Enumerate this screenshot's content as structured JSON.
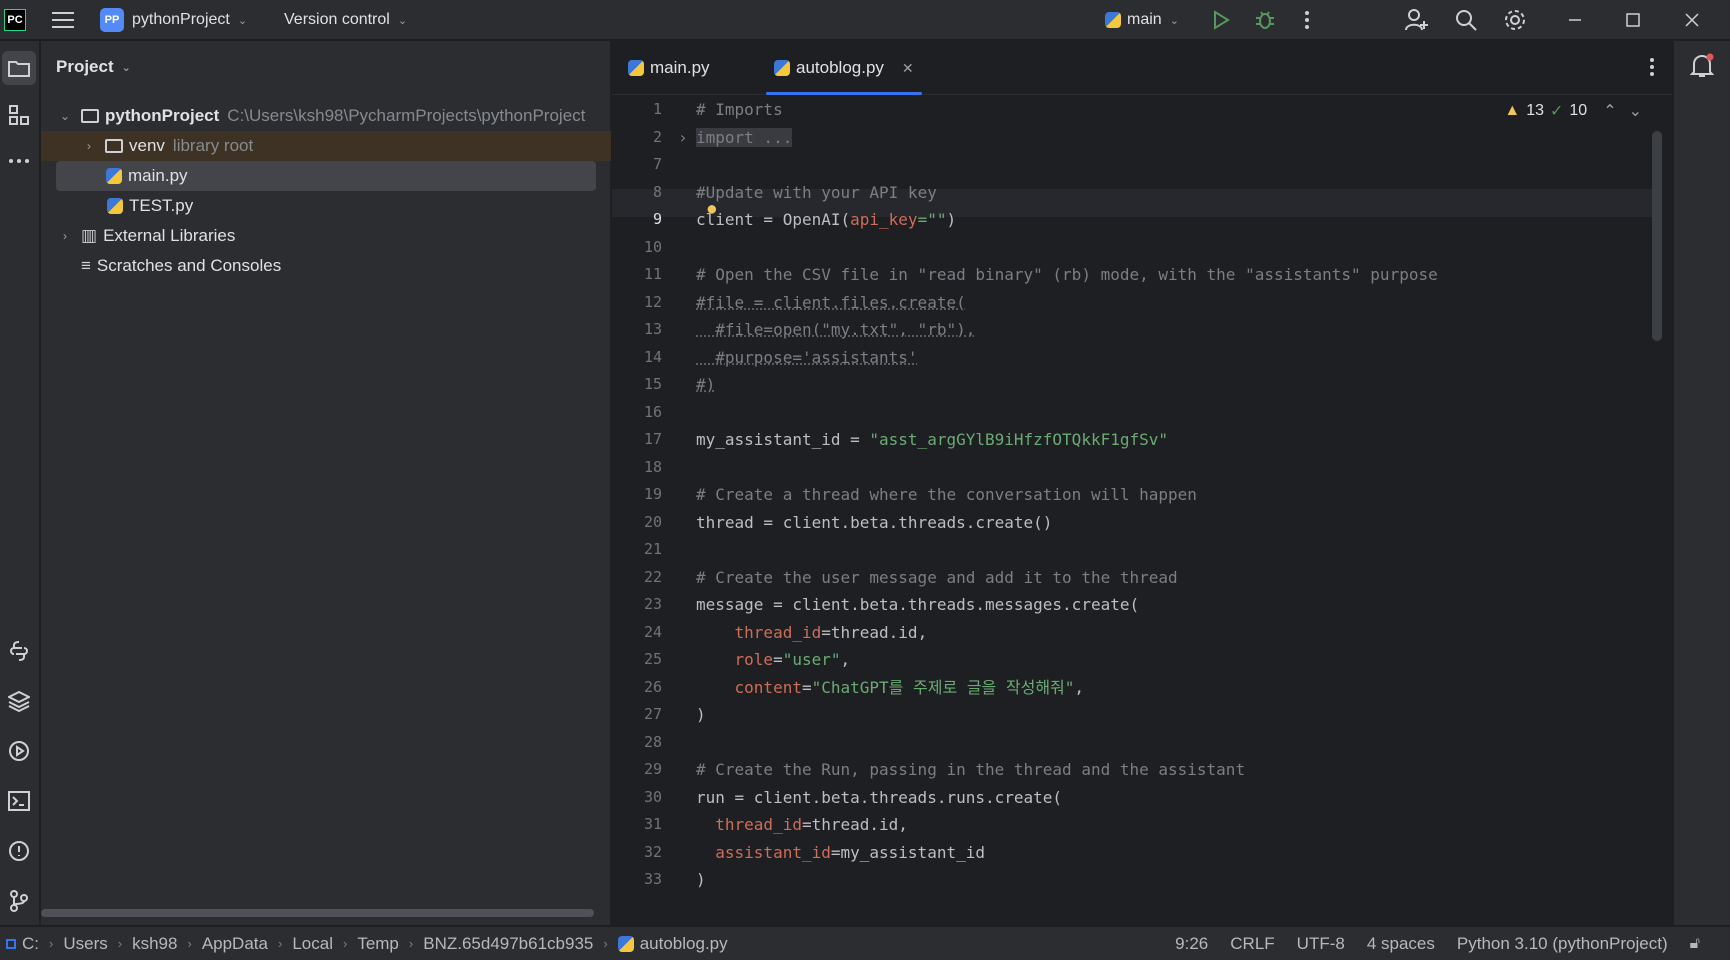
{
  "titlebar": {
    "project_badge": "PP",
    "project_name": "pythonProject",
    "vcs_label": "Version control",
    "run_config": "main",
    "icons": [
      "menu-icon",
      "run-icon",
      "debug-icon",
      "more-icon",
      "add-user-icon",
      "search-icon",
      "gear-icon",
      "minimize-icon",
      "maximize-icon",
      "close-icon"
    ]
  },
  "project_panel": {
    "title": "Project",
    "root_name": "pythonProject",
    "root_path": "C:\\Users\\ksh98\\PycharmProjects\\pythonProject",
    "venv_name": "venv",
    "venv_hint": "library root",
    "files": [
      "main.py",
      "TEST.py"
    ],
    "external_libraries": "External Libraries",
    "scratches": "Scratches and Consoles"
  },
  "editor": {
    "tabs": [
      {
        "label": "main.py"
      },
      {
        "label": "autoblog.py"
      }
    ],
    "warnings": "13",
    "ok_count": "10",
    "line_numbers": [
      "1",
      "2",
      "7",
      "8",
      "9",
      "10",
      "11",
      "12",
      "13",
      "14",
      "15",
      "16",
      "17",
      "18",
      "19",
      "20",
      "21",
      "22",
      "23",
      "24",
      "25",
      "26",
      "27",
      "28",
      "29",
      "30",
      "31",
      "32",
      "33"
    ],
    "code": {
      "l1": "# Imports",
      "l2": "import ...",
      "l8_a": "#",
      "l8_b": "Update with your API key",
      "l9_a": "client = OpenAI(",
      "l9_b": "api_key",
      "l9_c": "=\"\"",
      "l9_d": ")",
      "l11": "# Open the CSV file in \"read binary\" (rb) mode, with the \"assistants\" purpose",
      "l12": "#file = client.files.create(",
      "l13": "  #file=open(\"my.txt\", \"rb\"),",
      "l14": "  #purpose='assistants'",
      "l15": "#)",
      "l17_a": "my_assistant_id = ",
      "l17_b": "\"asst_argGYlB9iHfzfOTQkkF1gfSv\"",
      "l19": "# Create a thread where the conversation will happen",
      "l20": "thread = client.beta.threads.create()",
      "l22": "# Create the user message and add it to the thread",
      "l23": "message = client.beta.threads.messages.create(",
      "l24_a": "    thread_id",
      "l24_b": "=thread.id,",
      "l25_a": "    role",
      "l25_b": "=",
      "l25_c": "\"user\"",
      "l25_d": ",",
      "l26_a": "    content",
      "l26_b": "=",
      "l26_c": "\"ChatGPT를 주제로 글을 작성해줘\"",
      "l26_d": ",",
      "l27": ")",
      "l29": "# Create the Run, passing in the thread and the assistant",
      "l30": "run = client.beta.threads.runs.create(",
      "l31_a": "  thread_id",
      "l31_b": "=thread.id,",
      "l32_a": "  assistant_id",
      "l32_b": "=my_assistant_id",
      "l33": ")"
    }
  },
  "statusbar": {
    "breadcrumb": [
      "C:",
      "Users",
      "ksh98",
      "AppData",
      "Local",
      "Temp",
      "BNZ.65d497b61cb935",
      "autoblog.py"
    ],
    "position": "9:26",
    "line_sep": "CRLF",
    "encoding": "UTF-8",
    "indent": "4 spaces",
    "interpreter": "Python 3.10 (pythonProject)"
  }
}
